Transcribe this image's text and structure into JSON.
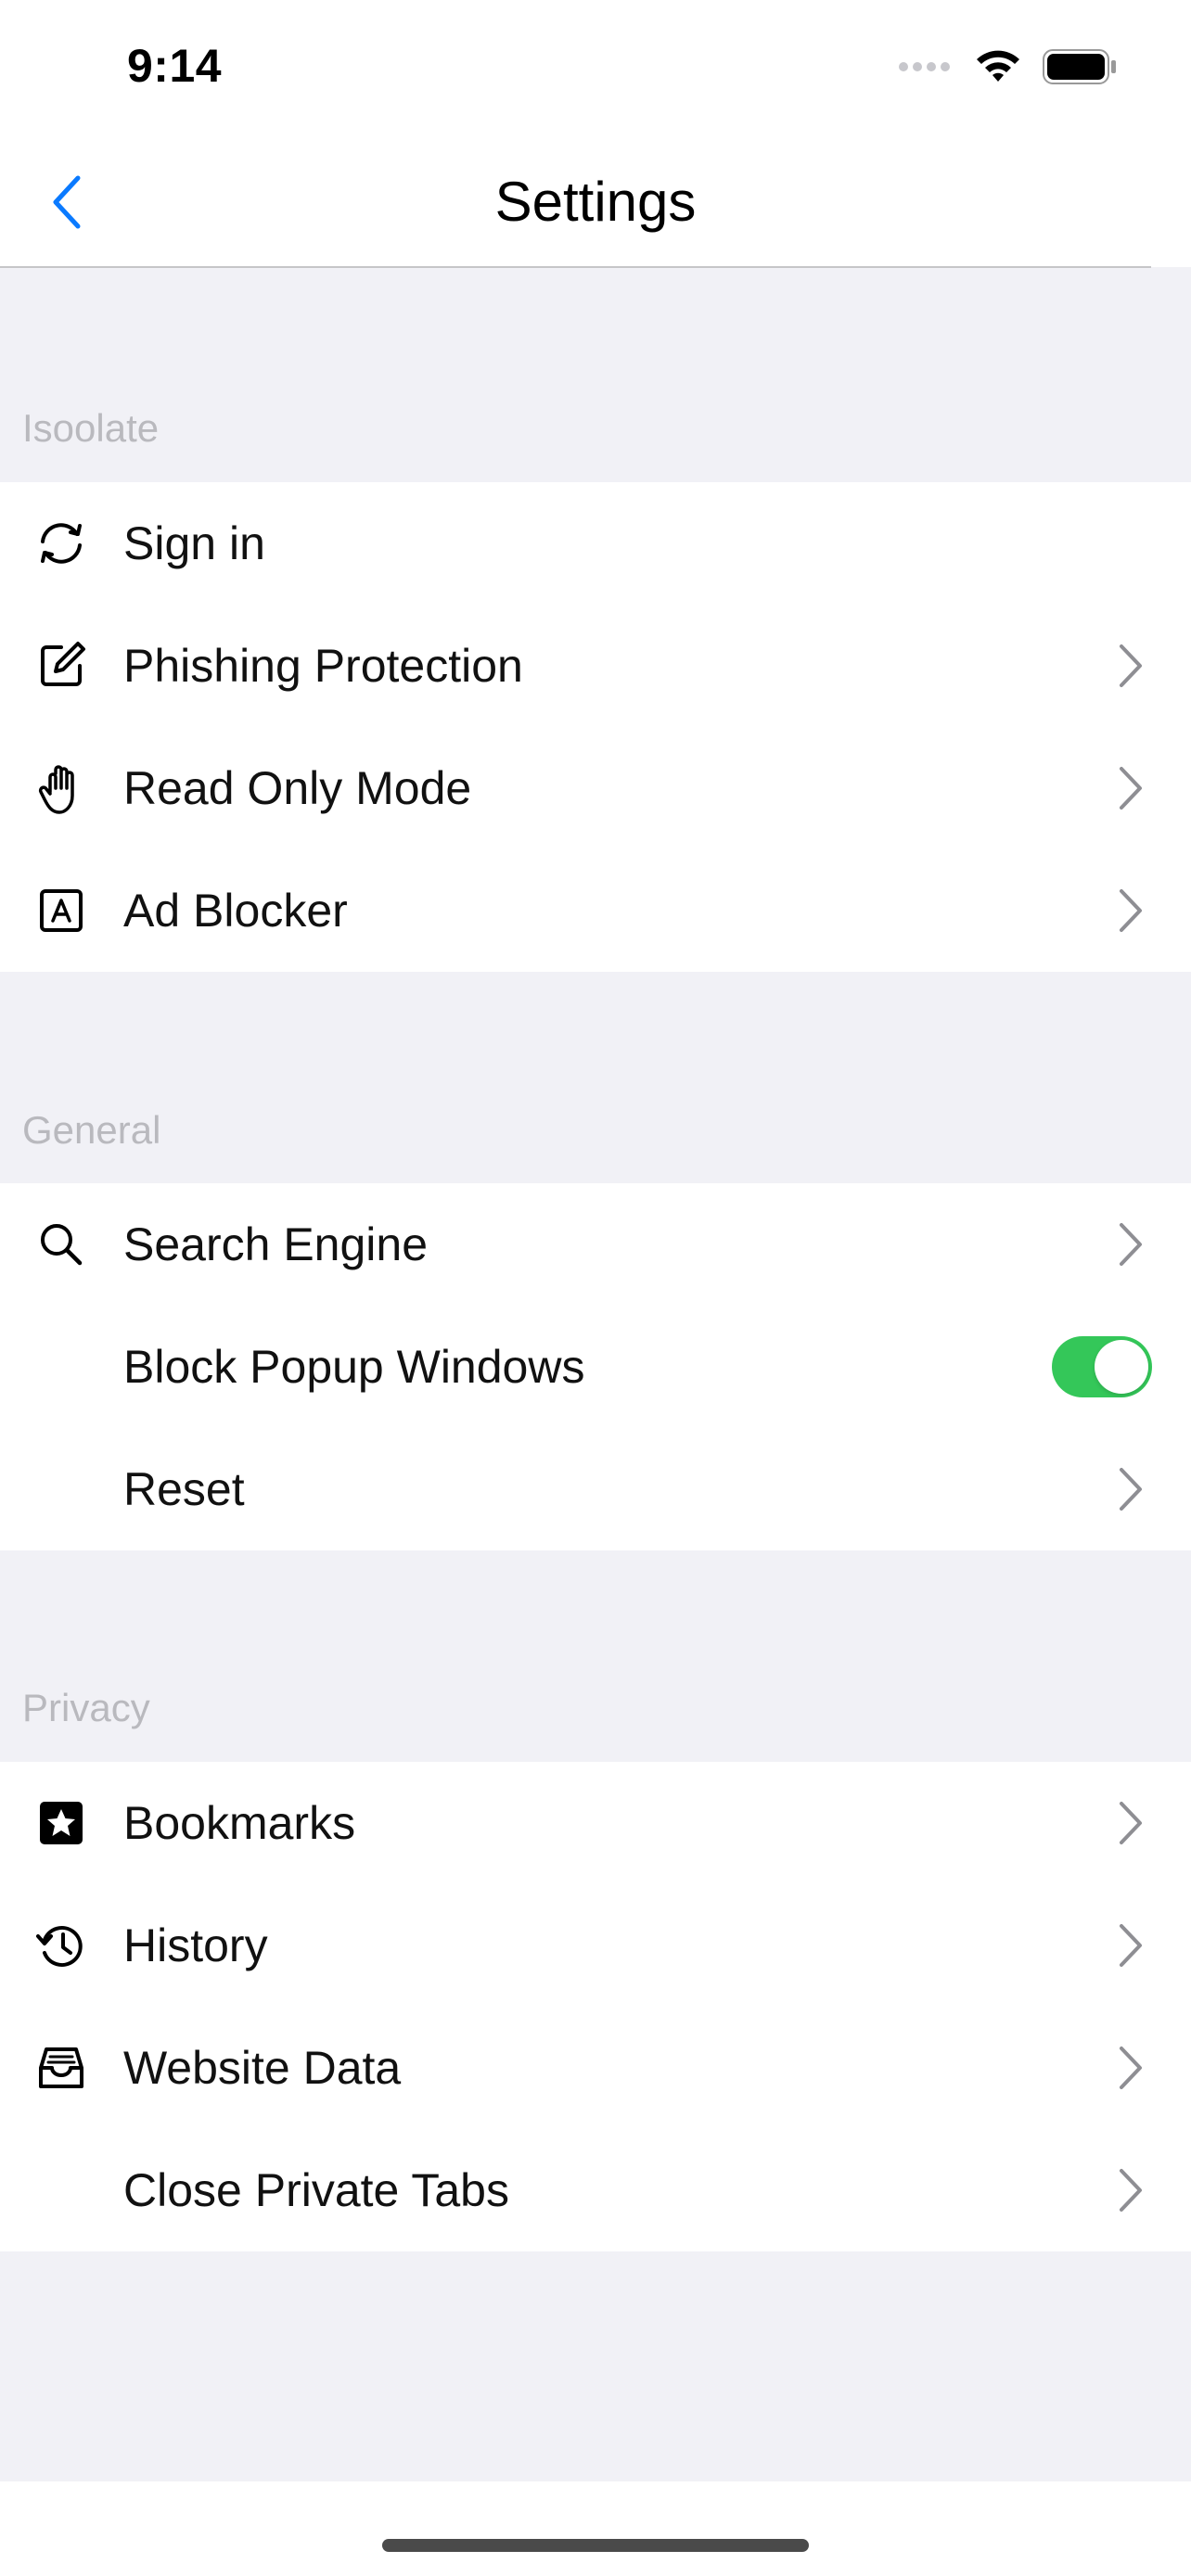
{
  "status": {
    "time": "9:14"
  },
  "nav": {
    "title": "Settings"
  },
  "sections": {
    "isoolate": {
      "header": "Isoolate",
      "items": [
        {
          "label": "Sign in",
          "icon": "sync-icon"
        },
        {
          "label": "Phishing Protection",
          "icon": "compose-icon"
        },
        {
          "label": "Read Only Mode",
          "icon": "hand-icon"
        },
        {
          "label": "Ad Blocker",
          "icon": "ad-box-icon"
        }
      ]
    },
    "general": {
      "header": "General",
      "items": [
        {
          "label": "Search Engine",
          "icon": "search-icon"
        },
        {
          "label": "Block Popup Windows",
          "toggle_on": true
        },
        {
          "label": "Reset"
        }
      ]
    },
    "privacy": {
      "header": "Privacy",
      "items": [
        {
          "label": "Bookmarks",
          "icon": "star-box-icon"
        },
        {
          "label": "History",
          "icon": "history-icon"
        },
        {
          "label": "Website Data",
          "icon": "tray-icon"
        },
        {
          "label": "Close Private Tabs"
        }
      ]
    }
  },
  "colors": {
    "accent": "#0a7aff",
    "toggle_on": "#34c759",
    "background": "#f1f1f6"
  }
}
